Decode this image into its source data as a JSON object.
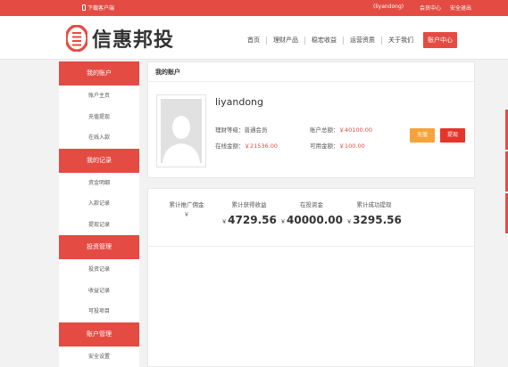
{
  "topbar": {
    "download": "下载客户端",
    "username": "(liyandong)",
    "user_center": "会员中心",
    "logout": "安全退出"
  },
  "brand": {
    "name": "信惠邦投"
  },
  "nav": {
    "items": [
      "首页",
      "理财产品",
      "稳宏收益",
      "运营资质",
      "关于我们"
    ],
    "account": "账户中心"
  },
  "sidebar": {
    "sections": [
      {
        "title": "我的账户",
        "items": [
          "账户主页",
          "充值提现",
          "在线入款"
        ]
      },
      {
        "title": "我的记录",
        "items": [
          "资金明细",
          "入款记录",
          "提现记录"
        ]
      },
      {
        "title": "投资管理",
        "items": [
          "投资记录",
          "收益记录",
          "可投项目"
        ]
      },
      {
        "title": "账户管理",
        "items": [
          "安全设置"
        ]
      }
    ]
  },
  "account": {
    "title": "我的账户",
    "username": "liyandong",
    "level_label": "理财等级：",
    "level_value": "普通会员",
    "balance_label": "在线金额：",
    "balance_value": "￥21536.00",
    "total_label": "账户总额：",
    "total_value": "￥40100.00",
    "available_label": "可用金额：",
    "available_value": "￥100.00",
    "recharge_label": "充值",
    "withdraw_label": "提现"
  },
  "stats": {
    "currency": "￥",
    "items": [
      {
        "label": "累计推广佣金",
        "value": ""
      },
      {
        "label": "累计获得收益",
        "value": "4729.56"
      },
      {
        "label": "在投资金",
        "value": "40000.00"
      },
      {
        "label": "累计成功提现",
        "value": "3295.56"
      }
    ]
  },
  "colors": {
    "accent": "#e44b43",
    "orange": "#f5a33b",
    "withdraw": "#e4352b"
  }
}
